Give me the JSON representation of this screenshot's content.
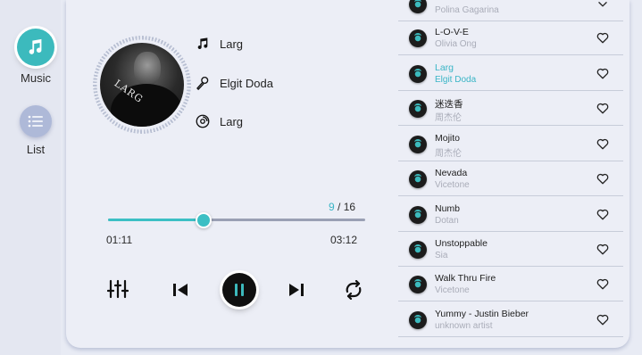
{
  "sidebar": {
    "items": [
      {
        "label": "Music",
        "icon": "music-note-icon",
        "active": true
      },
      {
        "label": "List",
        "icon": "list-icon",
        "active": false
      }
    ]
  },
  "now_playing": {
    "album_cover_text": "LARG",
    "title": "Larg",
    "artist": "Elgit Doda",
    "album": "Larg"
  },
  "progress": {
    "current_index": "9",
    "separator": " / ",
    "total": "16",
    "elapsed": "01:11",
    "duration": "03:12",
    "fraction": 0.37
  },
  "controls": {
    "equalizer": "equalizer-icon",
    "previous": "skip-previous-icon",
    "play_pause": "pause-icon",
    "next": "skip-next-icon",
    "repeat": "repeat-icon"
  },
  "colors": {
    "accent": "#3cbabd",
    "accent_text": "#3ab5c6"
  },
  "playlist": [
    {
      "title": "",
      "artist": "Polina Gagarina",
      "active": false,
      "icon": "chevron-down-icon"
    },
    {
      "title": "L-O-V-E",
      "artist": "Olivia Ong",
      "active": false,
      "icon": "heart-icon"
    },
    {
      "title": "Larg",
      "artist": "Elgit Doda",
      "active": true,
      "icon": "heart-icon"
    },
    {
      "title": "迷迭香",
      "artist": "周杰伦",
      "active": false,
      "icon": "heart-icon"
    },
    {
      "title": "Mojito",
      "artist": "周杰伦",
      "active": false,
      "icon": "heart-icon"
    },
    {
      "title": "Nevada",
      "artist": "Vicetone",
      "active": false,
      "icon": "heart-icon"
    },
    {
      "title": "Numb",
      "artist": "Dotan",
      "active": false,
      "icon": "heart-icon"
    },
    {
      "title": "Unstoppable",
      "artist": "Sia",
      "active": false,
      "icon": "heart-icon"
    },
    {
      "title": "Walk Thru Fire",
      "artist": "Vicetone",
      "active": false,
      "icon": "heart-icon"
    },
    {
      "title": "Yummy - Justin Bieber",
      "artist": "unknown artist",
      "active": false,
      "icon": "heart-icon"
    }
  ]
}
